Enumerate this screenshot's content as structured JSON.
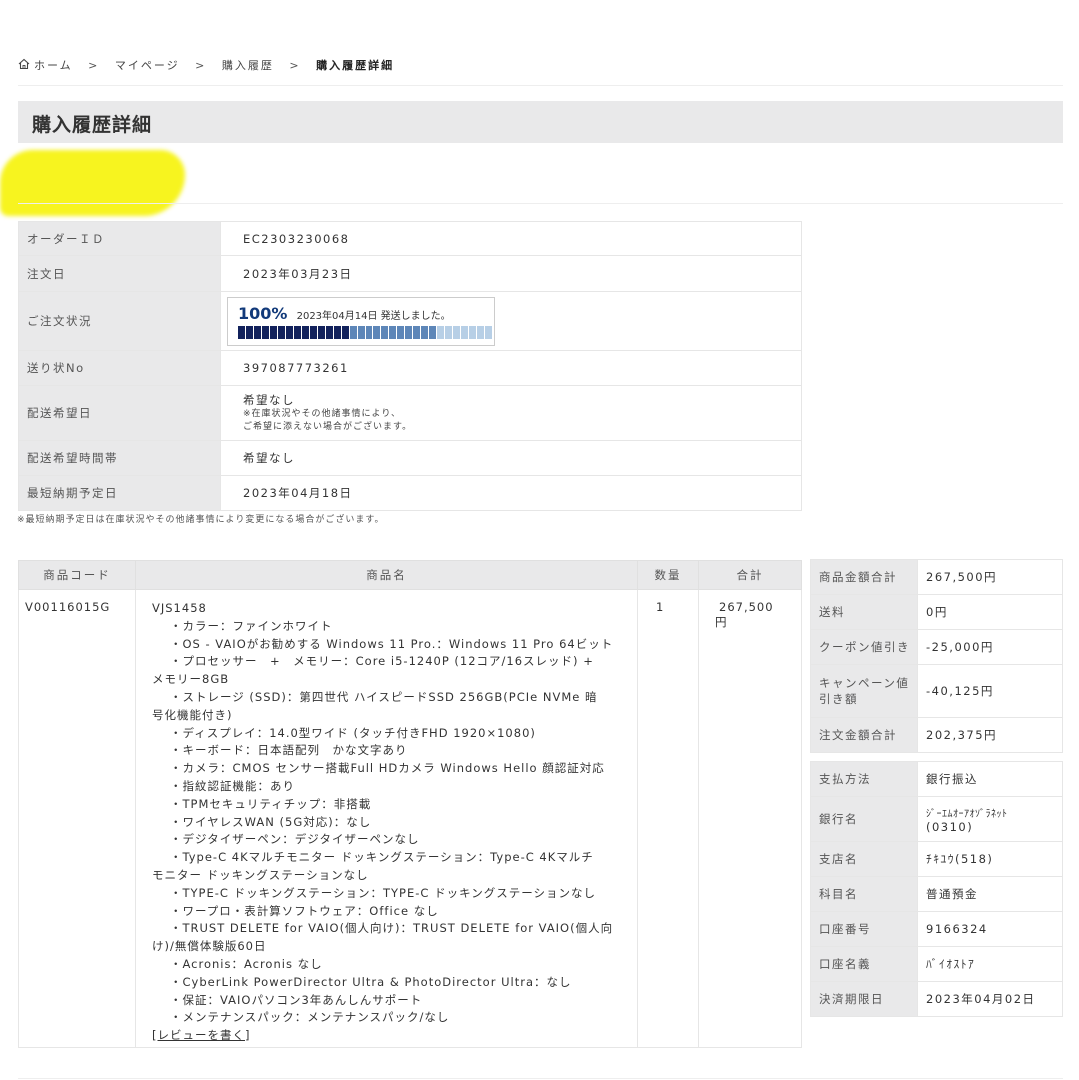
{
  "breadcrumb": {
    "home": "ホーム",
    "sep": ">",
    "mypage": "マイページ",
    "history": "購入履歴",
    "current": "購入履歴詳細"
  },
  "page_title": "購入履歴詳細",
  "order_info": {
    "order_id_label": "オーダーＩＤ",
    "order_id": "EC2303230068",
    "order_date_label": "注文日",
    "order_date": "2023年03月23日",
    "status_label": "ご注文状況",
    "status_percent": "100%",
    "status_text": "2023年04月14日 発送しました。",
    "progress_fraction": 1.0,
    "tracking_label": "送り状No",
    "tracking_no": "397087773261",
    "delivery_date_label": "配送希望日",
    "delivery_date": "希望なし",
    "delivery_note_1": "※在庫状況やその他諸事情により、",
    "delivery_note_2": "ご希望に添えない場合がございます。",
    "delivery_time_label": "配送希望時間帯",
    "delivery_time": "希望なし",
    "earliest_label": "最短納期予定日",
    "earliest_date": "2023年04月18日",
    "footnote": "※最短納期予定日は在庫状況やその他諸事情により変更になる場合がございます。"
  },
  "product_table": {
    "headers": {
      "code": "商品コード",
      "name": "商品名",
      "qty": "数量",
      "total": "合計"
    },
    "row": {
      "code": "V00116015G",
      "model": "VJS1458",
      "specs": [
        {
          "t": "・カラー：ファインホワイト",
          "ind": true
        },
        {
          "t": "・OS - VAIOがお勧めする Windows 11 Pro.：Windows 11 Pro 64ビット",
          "ind": true
        },
        {
          "t": "・プロセッサー　+　メモリー：Core i5-1240P (12コア/16スレッド) +",
          "ind": true
        },
        {
          "t": "メモリー8GB",
          "ind": false
        },
        {
          "t": "・ストレージ (SSD)：第四世代 ハイスピードSSD 256GB(PCIe NVMe 暗",
          "ind": true
        },
        {
          "t": "号化機能付き)",
          "ind": false
        },
        {
          "t": "・ディスプレイ：14.0型ワイド (タッチ付きFHD 1920×1080)",
          "ind": true
        },
        {
          "t": "・キーボード：日本語配列　かな文字あり",
          "ind": true
        },
        {
          "t": "・カメラ：CMOS センサー搭載Full HDカメラ Windows Hello 顔認証対応",
          "ind": true
        },
        {
          "t": "・指紋認証機能：あり",
          "ind": true
        },
        {
          "t": "・TPMセキュリティチップ：非搭載",
          "ind": true
        },
        {
          "t": "・ワイヤレスWAN (5G対応)：なし",
          "ind": true
        },
        {
          "t": "・デジタイザーペン：デジタイザーペンなし",
          "ind": true
        },
        {
          "t": "・Type-C 4Kマルチモニター ドッキングステーション：Type-C 4Kマルチ",
          "ind": true
        },
        {
          "t": "モニター ドッキングステーションなし",
          "ind": false
        },
        {
          "t": "・TYPE-C ドッキングステーション：TYPE-C ドッキングステーションなし",
          "ind": true
        },
        {
          "t": "・ワープロ・表計算ソフトウェア：Office なし",
          "ind": true
        },
        {
          "t": "・TRUST DELETE for VAIO(個人向け)：TRUST DELETE for VAIO(個人向",
          "ind": true
        },
        {
          "t": "け)/無償体験版60日",
          "ind": false
        },
        {
          "t": "・Acronis：Acronis なし",
          "ind": true
        },
        {
          "t": "・CyberLink PowerDirector Ultra & PhotoDirector Ultra：なし",
          "ind": true
        },
        {
          "t": "・保証：VAIOパソコン3年あんしんサポート",
          "ind": true
        },
        {
          "t": "・メンテナンスパック：メンテナンスパック/なし",
          "ind": true
        }
      ],
      "review_link": "レビューを書く",
      "qty": "1",
      "total_line1": "267,500",
      "total_line2": "円"
    }
  },
  "summary": {
    "subtotal_label": "商品金額合計",
    "subtotal": "267,500円",
    "shipping_label": "送料",
    "shipping": "0円",
    "coupon_label": "クーポン値引き",
    "coupon": "-25,000円",
    "campaign_label_1": "キャンペーン値",
    "campaign_label_2": "引き額",
    "campaign": "-40,125円",
    "order_total_label": "注文金額合計",
    "order_total": "202,375円"
  },
  "payment": {
    "method_label": "支払方法",
    "method": "銀行振込",
    "bank_label": "銀行名",
    "bank_line1": "ｼﾞｰｴﾑｵｰｱｵｿﾞﾗﾈｯﾄ",
    "bank_line2": "(0310)",
    "branch_label": "支店名",
    "branch": "ﾁｷﾕｳ(518)",
    "account_type_label": "科目名",
    "account_type": "普通預金",
    "account_no_label": "口座番号",
    "account_no": "9166324",
    "holder_label": "口座名義",
    "holder": "ﾊﾞｲｵｽﾄｱ",
    "deadline_label": "決済期限日",
    "deadline": "2023年04月02日"
  },
  "colors": {
    "progress_dark": "#12225c",
    "progress_mid": "#5d86b8",
    "progress_light": "#b7cfe6",
    "highlight": "#f7f41f",
    "label_bg": "#e9e9ea"
  }
}
